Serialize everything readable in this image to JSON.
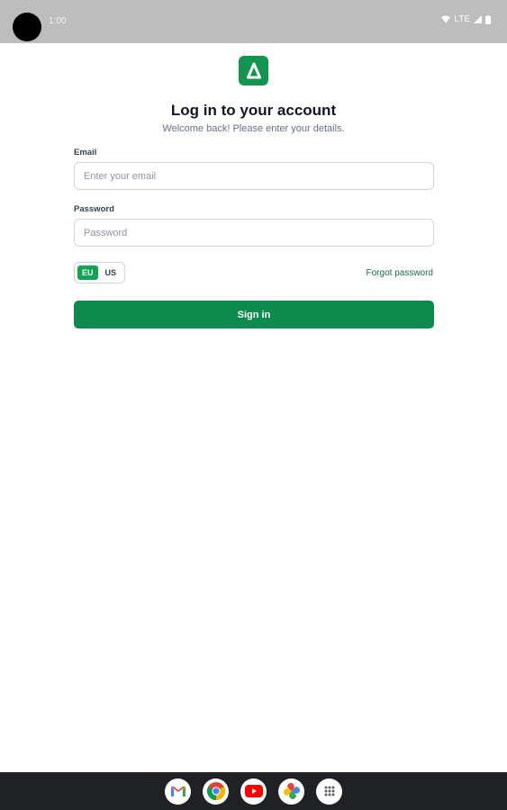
{
  "status_bar": {
    "time": "1:00",
    "network": "LTE"
  },
  "header": {
    "title": "Log in to your account",
    "subtitle": "Welcome back! Please enter your details."
  },
  "form": {
    "email_label": "Email",
    "email_placeholder": "Enter your email",
    "email_value": "",
    "password_label": "Password",
    "password_placeholder": "Password",
    "password_value": "",
    "region_options": [
      "EU",
      "US"
    ],
    "region_selected": "EU",
    "forgot_label": "Forgot password",
    "signin_label": "Sign in"
  },
  "colors": {
    "brand": "#12954f",
    "button": "#0d8a4d",
    "status_bar": "#bdbdbd",
    "dock": "#202124"
  },
  "dock": {
    "apps": [
      "gmail-icon",
      "chrome-icon",
      "youtube-icon",
      "photos-icon",
      "app-drawer-icon"
    ]
  }
}
